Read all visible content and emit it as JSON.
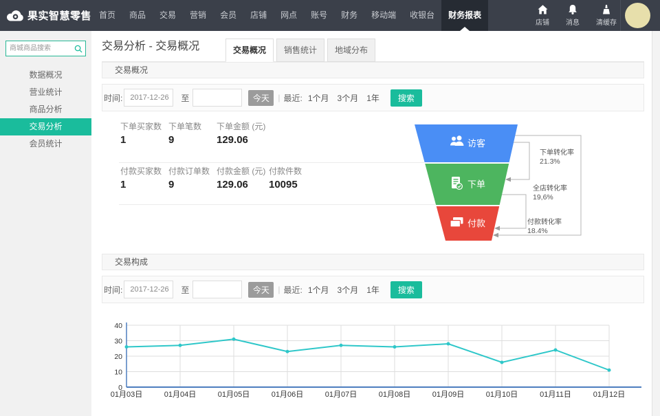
{
  "nav": {
    "brand": "果实智慧零售",
    "items": [
      "首页",
      "商品",
      "交易",
      "营销",
      "会员",
      "店铺",
      "网点",
      "账号",
      "财务",
      "移动端",
      "收银台",
      "财务报表"
    ],
    "active": "财务报表",
    "quick": [
      {
        "icon": "store-icon",
        "label": "店铺"
      },
      {
        "icon": "message-icon",
        "label": "消息"
      },
      {
        "icon": "clear-cache-icon",
        "label": "清缓存"
      }
    ]
  },
  "sidebar": {
    "search_placeholder": "商城商品搜索",
    "items": [
      "数据概况",
      "营业统计",
      "商品分析",
      "交易分析",
      "会员统计"
    ],
    "active": "交易分析"
  },
  "page": {
    "title": "交易分析 - 交易概况",
    "tabs": [
      "交易概况",
      "销售统计",
      "地域分布"
    ],
    "active_tab": "交易概况"
  },
  "sections": {
    "overview": "交易概况",
    "composition": "交易构成"
  },
  "filters": {
    "time_label": "时间:",
    "date_from": "2017-12-26",
    "to_label": "至",
    "date_to": "",
    "today_label": "今天",
    "divider": "|",
    "recent_label": "最近:",
    "ranges": [
      "1个月",
      "3个月",
      "1年"
    ],
    "search_label": "搜索"
  },
  "stats": {
    "order_row": [
      {
        "label": "下单买家数",
        "value": "1"
      },
      {
        "label": "下单笔数",
        "value": "9"
      },
      {
        "label": "下单金额 (元)",
        "value": "129.06"
      }
    ],
    "payment_row": [
      {
        "label": "付款买家数",
        "value": "1"
      },
      {
        "label": "付款订单数",
        "value": "9"
      },
      {
        "label": "付款金额 (元)",
        "value": "129.06"
      },
      {
        "label": "付款件数",
        "value": "10095"
      }
    ]
  },
  "funnel": {
    "stages": [
      {
        "label": "访客",
        "color": "#4a8ef5",
        "icon": "visitors-icon"
      },
      {
        "label": "下单",
        "color": "#4db55f",
        "icon": "order-icon"
      },
      {
        "label": "付款",
        "color": "#e8473b",
        "icon": "payment-icon"
      }
    ],
    "rates": [
      {
        "label": "下单转化率",
        "value": "21.3%"
      },
      {
        "label": "全店转化率",
        "value": "19,6%"
      },
      {
        "label": "付款转化率",
        "value": "18.4%"
      }
    ]
  },
  "chart_data": {
    "type": "line",
    "x": [
      "01月03日",
      "01月04日",
      "01月05日",
      "01月06日",
      "01月07日",
      "01月08日",
      "01月09日",
      "01月10日",
      "01月11日",
      "01月12日"
    ],
    "values": [
      26,
      27,
      31,
      23,
      27,
      26,
      28,
      16,
      24,
      11
    ],
    "ylim": [
      0,
      40
    ],
    "yticks": [
      0,
      10,
      20,
      30,
      40
    ],
    "title": "",
    "xlabel": "",
    "ylabel": "",
    "legend": [],
    "grid": true,
    "line_color": "#2ec7c9",
    "axis_color": "#4d7ebf"
  }
}
